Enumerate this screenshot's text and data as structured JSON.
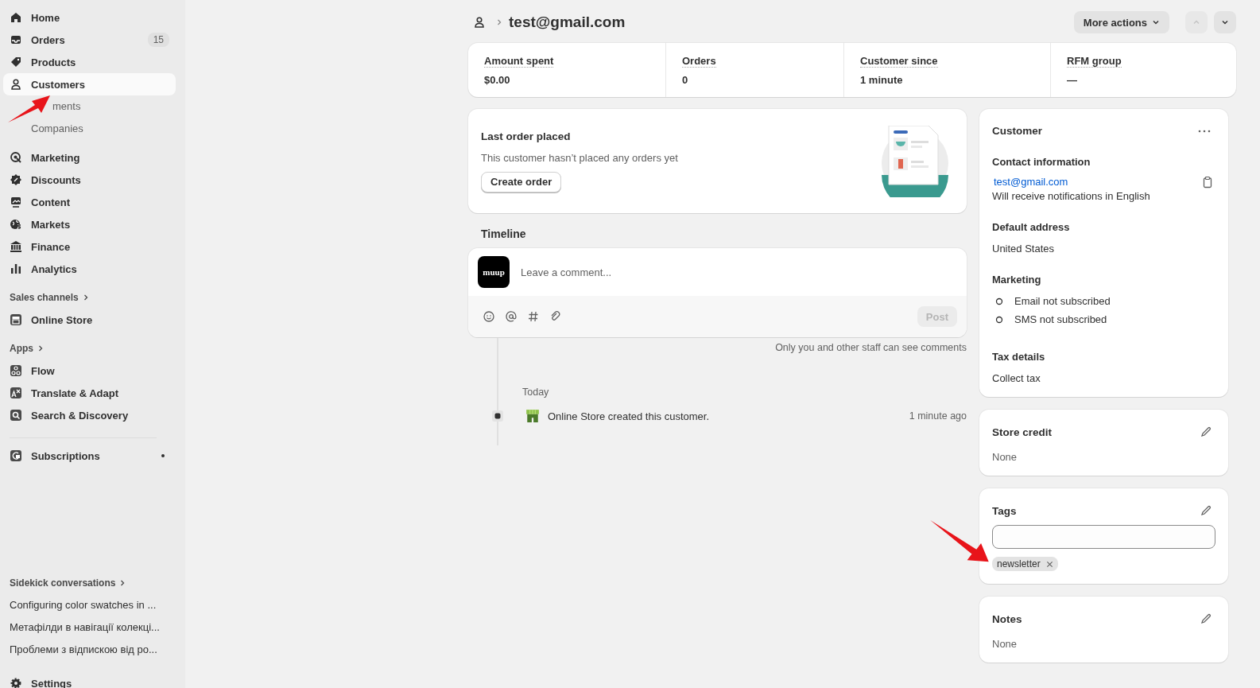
{
  "sidebar": {
    "main": [
      {
        "label": "Home",
        "selected": false
      },
      {
        "label": "Orders",
        "selected": false,
        "badge": "15"
      },
      {
        "label": "Products",
        "selected": false
      },
      {
        "label": "Customers",
        "selected": true,
        "children": [
          {
            "label": "ments",
            "selected": false
          },
          {
            "label": "Companies",
            "selected": false
          }
        ]
      }
    ],
    "secondary": [
      {
        "label": "Marketing",
        "selected": false
      },
      {
        "label": "Discounts",
        "selected": false
      },
      {
        "label": "Content",
        "selected": false
      },
      {
        "label": "Markets",
        "selected": false
      },
      {
        "label": "Finance",
        "selected": false
      },
      {
        "label": "Analytics",
        "selected": false
      }
    ],
    "sales_channels": {
      "heading": "Sales channels",
      "items": [
        {
          "label": "Online Store",
          "selected": false
        }
      ]
    },
    "apps": {
      "heading": "Apps",
      "items": [
        {
          "label": "Flow",
          "selected": false
        },
        {
          "label": "Translate & Adapt",
          "selected": false
        },
        {
          "label": "Search & Discovery",
          "selected": false
        }
      ]
    },
    "subscriptions": {
      "label": "Subscriptions",
      "selected": false
    },
    "sidekick": {
      "heading": "Sidekick conversations",
      "items": [
        "Configuring color swatches in ...",
        "Метафілди в навігації колекці...",
        "Проблеми з відпискою від ро..."
      ]
    },
    "settings": {
      "label": "Settings"
    }
  },
  "header": {
    "title": "test@gmail.com",
    "more_actions": "More actions",
    "previous_disabled": true
  },
  "stats": [
    {
      "label": "Amount spent",
      "value": "$0.00"
    },
    {
      "label": "Orders",
      "value": "0"
    },
    {
      "label": "Customer since",
      "value": "1 minute"
    },
    {
      "label": "RFM group",
      "value": "—"
    }
  ],
  "last_order": {
    "title": "Last order placed",
    "text": "This customer hasn’t placed any orders yet",
    "button": "Create order"
  },
  "timeline": {
    "heading": "Timeline",
    "avatar": "muup",
    "placeholder": "Leave a comment...",
    "post": "Post",
    "post_disabled": true,
    "note": "Only you and other staff can see comments",
    "day": "Today",
    "events": [
      {
        "text": "Online Store created this customer.",
        "time": "1 minute ago"
      }
    ]
  },
  "customer": {
    "title": "Customer",
    "contact_heading": "Contact information",
    "email": "test@gmail.com",
    "language": "Will receive notifications in English",
    "address_heading": "Default address",
    "address": "United States",
    "marketing_heading": "Marketing",
    "marketing": [
      {
        "label": "Email not subscribed",
        "subscribed": false
      },
      {
        "label": "SMS not subscribed",
        "subscribed": false
      }
    ],
    "tax_heading": "Tax details",
    "tax": "Collect tax"
  },
  "store_credit": {
    "title": "Store credit",
    "value": "None"
  },
  "tags": {
    "title": "Tags",
    "items": [
      "newsletter"
    ]
  },
  "notes": {
    "title": "Notes",
    "value": "None"
  }
}
